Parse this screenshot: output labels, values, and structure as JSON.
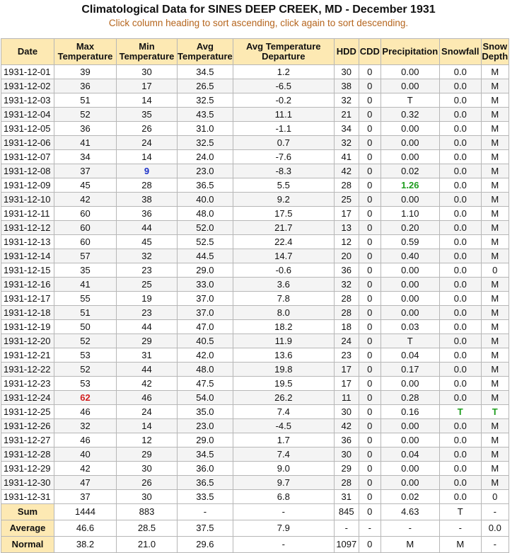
{
  "title": "Climatological Data for SINES DEEP CREEK, MD - December 1931",
  "subtitle": "Click column heading to sort ascending, click again to sort descending.",
  "headers": [
    "Date",
    "Max Temperature",
    "Min Temperature",
    "Avg Temperature",
    "Avg Temperature Departure",
    "HDD",
    "CDD",
    "Precipitation",
    "Snowfall",
    "Snow Depth"
  ],
  "highlight_colors": {
    "max_record": "#d21f1f",
    "min_record": "#1b30c8",
    "notable": "#1f9d1f",
    "header_bg": "#fde9b3"
  },
  "rows": [
    [
      "1931-12-01",
      "39",
      "30",
      "34.5",
      "1.2",
      "30",
      "0",
      "0.00",
      "0.0",
      "M"
    ],
    [
      "1931-12-02",
      "36",
      "17",
      "26.5",
      "-6.5",
      "38",
      "0",
      "0.00",
      "0.0",
      "M"
    ],
    [
      "1931-12-03",
      "51",
      "14",
      "32.5",
      "-0.2",
      "32",
      "0",
      "T",
      "0.0",
      "M"
    ],
    [
      "1931-12-04",
      "52",
      "35",
      "43.5",
      "11.1",
      "21",
      "0",
      "0.32",
      "0.0",
      "M"
    ],
    [
      "1931-12-05",
      "36",
      "26",
      "31.0",
      "-1.1",
      "34",
      "0",
      "0.00",
      "0.0",
      "M"
    ],
    [
      "1931-12-06",
      "41",
      "24",
      "32.5",
      "0.7",
      "32",
      "0",
      "0.00",
      "0.0",
      "M"
    ],
    [
      "1931-12-07",
      "34",
      "14",
      "24.0",
      "-7.6",
      "41",
      "0",
      "0.00",
      "0.0",
      "M"
    ],
    [
      "1931-12-08",
      "37",
      "9",
      "23.0",
      "-8.3",
      "42",
      "0",
      "0.02",
      "0.0",
      "M"
    ],
    [
      "1931-12-09",
      "45",
      "28",
      "36.5",
      "5.5",
      "28",
      "0",
      "1.26",
      "0.0",
      "M"
    ],
    [
      "1931-12-10",
      "42",
      "38",
      "40.0",
      "9.2",
      "25",
      "0",
      "0.00",
      "0.0",
      "M"
    ],
    [
      "1931-12-11",
      "60",
      "36",
      "48.0",
      "17.5",
      "17",
      "0",
      "1.10",
      "0.0",
      "M"
    ],
    [
      "1931-12-12",
      "60",
      "44",
      "52.0",
      "21.7",
      "13",
      "0",
      "0.20",
      "0.0",
      "M"
    ],
    [
      "1931-12-13",
      "60",
      "45",
      "52.5",
      "22.4",
      "12",
      "0",
      "0.59",
      "0.0",
      "M"
    ],
    [
      "1931-12-14",
      "57",
      "32",
      "44.5",
      "14.7",
      "20",
      "0",
      "0.40",
      "0.0",
      "M"
    ],
    [
      "1931-12-15",
      "35",
      "23",
      "29.0",
      "-0.6",
      "36",
      "0",
      "0.00",
      "0.0",
      "0"
    ],
    [
      "1931-12-16",
      "41",
      "25",
      "33.0",
      "3.6",
      "32",
      "0",
      "0.00",
      "0.0",
      "M"
    ],
    [
      "1931-12-17",
      "55",
      "19",
      "37.0",
      "7.8",
      "28",
      "0",
      "0.00",
      "0.0",
      "M"
    ],
    [
      "1931-12-18",
      "51",
      "23",
      "37.0",
      "8.0",
      "28",
      "0",
      "0.00",
      "0.0",
      "M"
    ],
    [
      "1931-12-19",
      "50",
      "44",
      "47.0",
      "18.2",
      "18",
      "0",
      "0.03",
      "0.0",
      "M"
    ],
    [
      "1931-12-20",
      "52",
      "29",
      "40.5",
      "11.9",
      "24",
      "0",
      "T",
      "0.0",
      "M"
    ],
    [
      "1931-12-21",
      "53",
      "31",
      "42.0",
      "13.6",
      "23",
      "0",
      "0.04",
      "0.0",
      "M"
    ],
    [
      "1931-12-22",
      "52",
      "44",
      "48.0",
      "19.8",
      "17",
      "0",
      "0.17",
      "0.0",
      "M"
    ],
    [
      "1931-12-23",
      "53",
      "42",
      "47.5",
      "19.5",
      "17",
      "0",
      "0.00",
      "0.0",
      "M"
    ],
    [
      "1931-12-24",
      "62",
      "46",
      "54.0",
      "26.2",
      "11",
      "0",
      "0.28",
      "0.0",
      "M"
    ],
    [
      "1931-12-25",
      "46",
      "24",
      "35.0",
      "7.4",
      "30",
      "0",
      "0.16",
      "T",
      "T"
    ],
    [
      "1931-12-26",
      "32",
      "14",
      "23.0",
      "-4.5",
      "42",
      "0",
      "0.00",
      "0.0",
      "M"
    ],
    [
      "1931-12-27",
      "46",
      "12",
      "29.0",
      "1.7",
      "36",
      "0",
      "0.00",
      "0.0",
      "M"
    ],
    [
      "1931-12-28",
      "40",
      "29",
      "34.5",
      "7.4",
      "30",
      "0",
      "0.04",
      "0.0",
      "M"
    ],
    [
      "1931-12-29",
      "42",
      "30",
      "36.0",
      "9.0",
      "29",
      "0",
      "0.00",
      "0.0",
      "M"
    ],
    [
      "1931-12-30",
      "47",
      "26",
      "36.5",
      "9.7",
      "28",
      "0",
      "0.00",
      "0.0",
      "M"
    ],
    [
      "1931-12-31",
      "37",
      "30",
      "33.5",
      "6.8",
      "31",
      "0",
      "0.02",
      "0.0",
      "0"
    ]
  ],
  "highlights": [
    {
      "row": 23,
      "col": 1,
      "kind": "hi"
    },
    {
      "row": 7,
      "col": 2,
      "kind": "lo"
    },
    {
      "row": 8,
      "col": 7,
      "kind": "grn"
    },
    {
      "row": 24,
      "col": 8,
      "kind": "grn"
    },
    {
      "row": 24,
      "col": 9,
      "kind": "grn"
    }
  ],
  "summary": [
    [
      "Sum",
      "1444",
      "883",
      "-",
      "-",
      "845",
      "0",
      "4.63",
      "T",
      "-"
    ],
    [
      "Average",
      "46.6",
      "28.5",
      "37.5",
      "7.9",
      "-",
      "-",
      "-",
      "-",
      "0.0"
    ],
    [
      "Normal",
      "38.2",
      "21.0",
      "29.6",
      "-",
      "1097",
      "0",
      "M",
      "M",
      "-"
    ]
  ]
}
